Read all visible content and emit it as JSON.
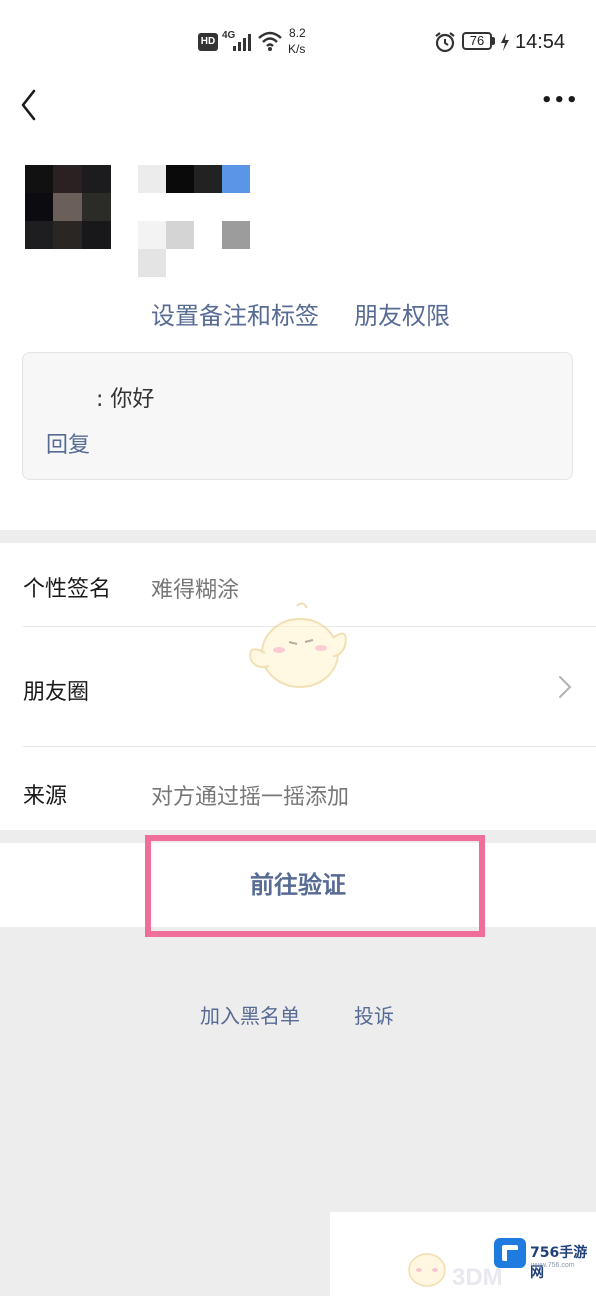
{
  "status_bar": {
    "hd": "HD",
    "network": "4G",
    "speed_value": "8.2",
    "speed_unit": "K/s",
    "battery": "76",
    "time": "14:54"
  },
  "header": {
    "menu_glyph": "•••"
  },
  "profile": {
    "actions": [
      "设置备注和标签",
      "朋友权限"
    ]
  },
  "message": {
    "text": ": 你好",
    "reply": "回复"
  },
  "info_rows": [
    {
      "label": "个性签名",
      "value": "难得糊涂"
    },
    {
      "label": "朋友圈",
      "value": ""
    },
    {
      "label": "来源",
      "value": "对方通过摇一摇添加"
    }
  ],
  "verify_button": "前往验证",
  "footer_links": [
    "加入黑名单",
    "投诉"
  ],
  "watermark": {
    "brand": "756手游网",
    "url": "www.756.com",
    "text": "3DM"
  },
  "colors": {
    "link": "#576b95",
    "highlight": "#ef6e9a",
    "background": "#ededed"
  },
  "icons": [
    "back-arrow-icon",
    "more-icon",
    "chevron-right-icon",
    "alarm-icon",
    "wifi-icon",
    "signal-icon",
    "charging-icon"
  ]
}
